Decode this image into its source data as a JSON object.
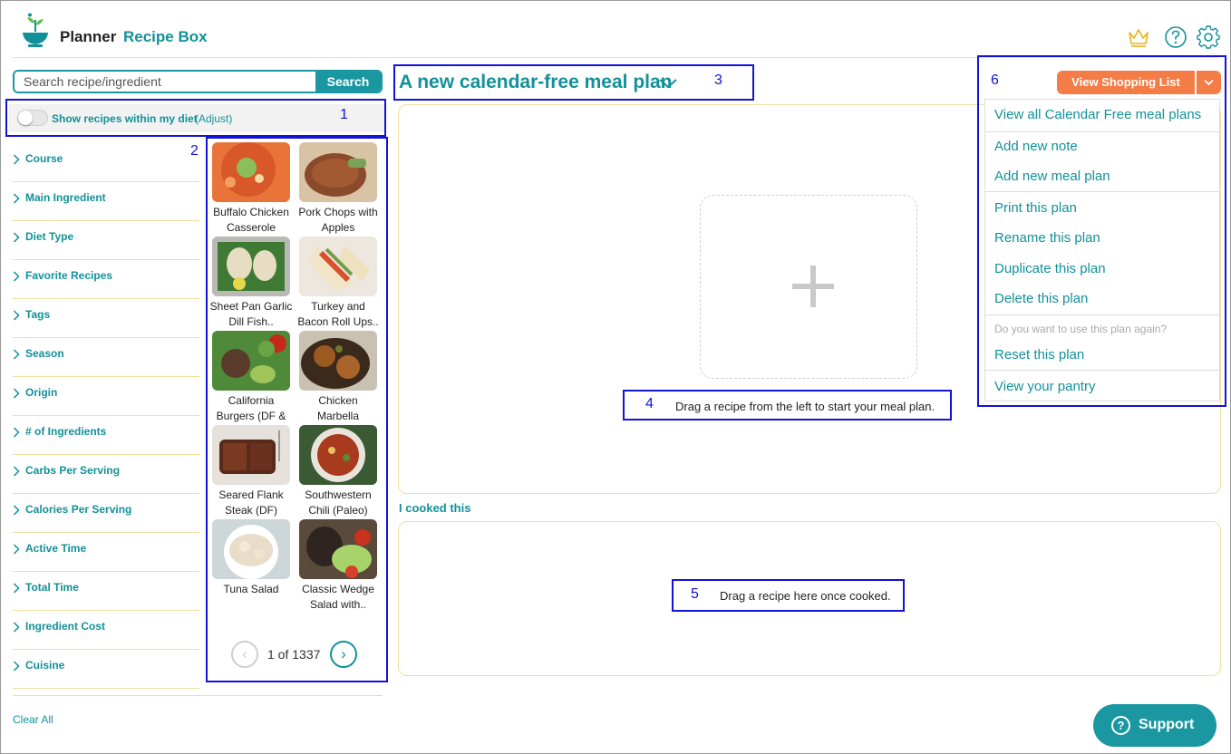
{
  "header": {
    "brand_main": "Planner",
    "brand_sub": "Recipe Box"
  },
  "search": {
    "placeholder": "Search recipe/ingredient",
    "button": "Search"
  },
  "diet": {
    "label": "Show recipes within my diet",
    "adjust": "(Adjust)",
    "enabled": false
  },
  "filters": [
    "Course",
    "Main Ingredient",
    "Diet Type",
    "Favorite Recipes",
    "Tags",
    "Season",
    "Origin",
    "# of Ingredients",
    "Carbs Per Serving",
    "Calories Per Serving",
    "Active Time",
    "Total Time",
    "Ingredient Cost",
    "Cuisine"
  ],
  "clear_all": "Clear All",
  "recipes": [
    {
      "line1": "Buffalo Chicken",
      "line2": "Casserole"
    },
    {
      "line1": "Pork Chops with",
      "line2": "Apples"
    },
    {
      "line1": "Sheet Pan Garlic",
      "line2": "Dill Fish.."
    },
    {
      "line1": "Turkey and",
      "line2": "Bacon Roll Ups.."
    },
    {
      "line1": "California",
      "line2": "Burgers (DF &"
    },
    {
      "line1": "Chicken",
      "line2": "Marbella"
    },
    {
      "line1": "Seared Flank",
      "line2": "Steak (DF)"
    },
    {
      "line1": "Southwestern",
      "line2": "Chili (Paleo)"
    },
    {
      "line1": "Tuna Salad",
      "line2": ""
    },
    {
      "line1": "Classic Wedge",
      "line2": "Salad with.."
    }
  ],
  "pager": {
    "text": "1 of 1337",
    "prev": "‹",
    "next": "›"
  },
  "plan": {
    "title": "A new calendar-free meal plan",
    "chevron": "∨"
  },
  "hints": {
    "start": "Drag a recipe from the left to start your meal plan.",
    "cooked_label": "I cooked this",
    "cooked": "Drag a recipe here once cooked."
  },
  "shopping": {
    "button": "View Shopping List",
    "caret": "⌄"
  },
  "menu": {
    "view_all": "View all Calendar Free meal plans",
    "add_note": "Add new note",
    "add_plan": "Add new meal plan",
    "print": "Print this plan",
    "rename": "Rename this plan",
    "duplicate": "Duplicate this plan",
    "delete": "Delete this plan",
    "question": "Do you want to use this plan again?",
    "reset": "Reset this plan",
    "pantry": "View your pantry"
  },
  "annotations": {
    "a1": "1",
    "a2": "2",
    "a3": "3",
    "a4": "4",
    "a5": "5",
    "a6": "6"
  },
  "support": {
    "label": "Support",
    "icon": "?"
  },
  "colors": {
    "teal": "#12919a",
    "orange": "#f47c46",
    "annotation": "#1212d8",
    "gold": "#e8b21c"
  },
  "icons": {
    "logo": "bowl-sprout-icon",
    "premium": "crown-icon",
    "help": "question-circle-icon",
    "settings": "gear-icon"
  }
}
